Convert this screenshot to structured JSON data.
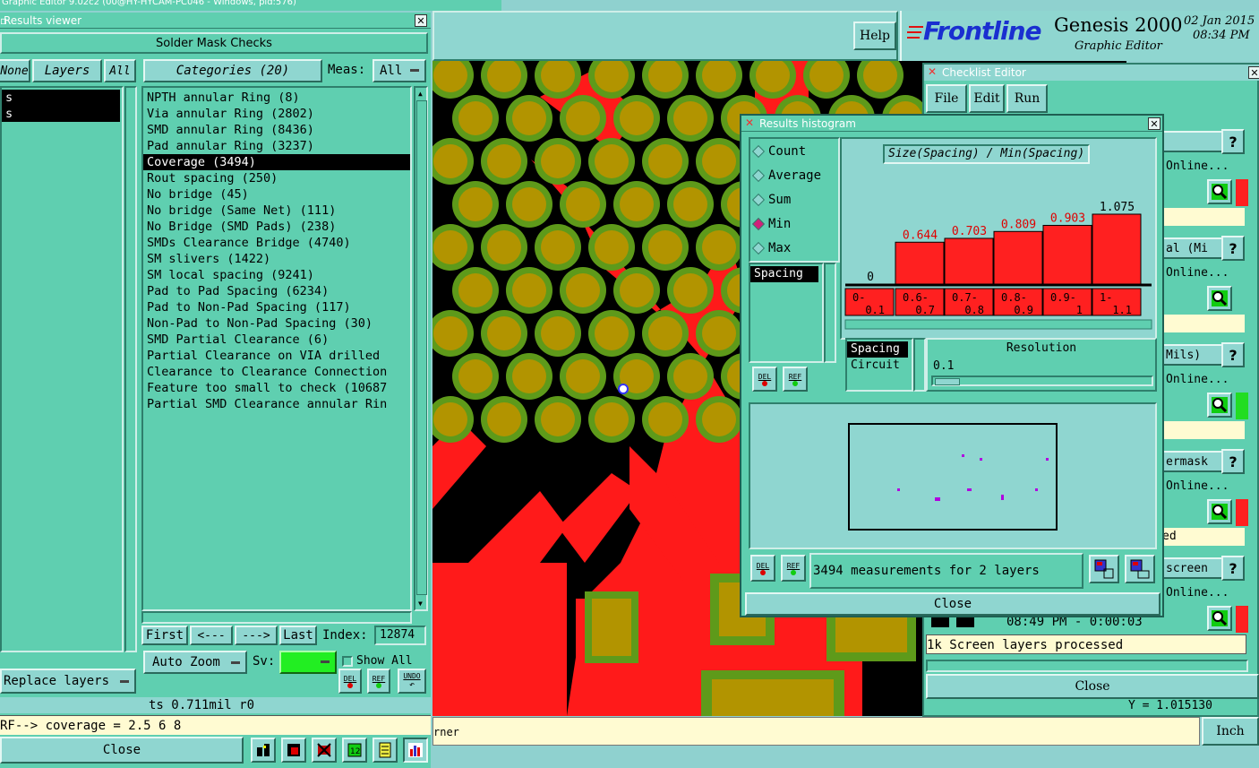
{
  "app": {
    "title": "Graphic Editor 9.02c2 (00@HY-HYCAM-PC046 - Windows, pid:576)",
    "help": "Help",
    "brand": "Frontline",
    "product": "Genesis 2000",
    "subtitle": "Graphic Editor",
    "date": "02 Jan 2015",
    "time": "08:34 PM",
    "bottom_msg": "rner",
    "units": "Inch"
  },
  "results_viewer": {
    "title": "Results viewer",
    "heading": "Solder Mask Checks",
    "none_label": "None",
    "layers_label": "Layers",
    "all_label": "All",
    "categories_label": "Categories (20)",
    "meas_label": "Meas:",
    "meas_value": "All",
    "layers": [
      "s",
      "s"
    ],
    "categories": [
      "NPTH annular Ring (8)",
      "Via annular Ring (2802)",
      "SMD annular Ring (8436)",
      "Pad annular Ring (3237)",
      "Coverage (3494)",
      "Rout spacing (250)",
      "No bridge (45)",
      "No bridge (Same Net) (111)",
      "No Bridge (SMD Pads) (238)",
      "SMDs Clearance Bridge (4740)",
      "SM slivers (1422)",
      "SM local spacing (9241)",
      "Pad to Pad Spacing (6234)",
      "Pad to Non-Pad Spacing (117)",
      "Non-Pad to Non-Pad Spacing (30)",
      "SMD Partial Clearance (6)",
      "Partial Clearance on VIA drilled",
      "Clearance to Clearance Connection",
      "Feature too small to check (10687",
      "Partial SMD Clearance annular Rin"
    ],
    "selected_category": 4,
    "first": "First",
    "prev": "<---",
    "next": "--->",
    "last": "Last",
    "index_label": "Index:",
    "index_value": "12874",
    "auto_zoom": "Auto Zoom",
    "sv_label": "Sv:",
    "show_all": "Show All",
    "replace_layers": "Replace layers",
    "del": "DEL",
    "ref": "REF",
    "undo": "UNDO",
    "status": "ts 0.711mil  r0",
    "message": "RF--> coverage = 2.5 6 8",
    "close": "Close"
  },
  "histogram": {
    "title": "Results histogram",
    "radios": [
      "Count",
      "Average",
      "Sum",
      "Min",
      "Max"
    ],
    "selected_radio": "Min",
    "chart_title": "Size(Spacing) / Min(Spacing)",
    "list1": [
      "Spacing"
    ],
    "list2": [
      "Spacing",
      "Circuit"
    ],
    "resolution_label": "Resolution",
    "resolution_value": "0.1",
    "measurements": "3494 measurements for 2 layers",
    "close": "Close",
    "del": "DEL",
    "ref": "REF"
  },
  "chart_data": {
    "type": "bar",
    "title": "Size(Spacing) / Min(Spacing)",
    "categories": [
      [
        "0-",
        "0.1"
      ],
      [
        "0.6-",
        "0.7"
      ],
      [
        "0.7-",
        "0.8"
      ],
      [
        "0.8-",
        "0.9"
      ],
      [
        "0.9-",
        "1"
      ],
      [
        "1-",
        "1.1"
      ]
    ],
    "values": [
      0,
      0.644,
      0.703,
      0.809,
      0.903,
      1.075
    ],
    "labels": [
      "0",
      "0.644",
      "0.703",
      "0.809",
      "0.903",
      "1.075"
    ],
    "bar_color": "#ff2020",
    "ylim": [
      0,
      1.075
    ]
  },
  "checklist": {
    "title": "Checklist Editor",
    "menu": [
      "File",
      "Edit",
      "Run"
    ],
    "rows": [
      {
        "text": "Online...",
        "tag": "",
        "status": "#ff2020"
      },
      {
        "text": "Online...",
        "tag": "al (Mi",
        "status": ""
      },
      {
        "text": "Online...",
        "tag": "Mils)",
        "status": "#22dd22"
      },
      {
        "text": "Online...",
        "tag": "ermask",
        "status": "#ff2020"
      },
      {
        "text": "Online...",
        "tag": "screen",
        "status": "#ff2020"
      }
    ],
    "yellow_texts": [
      "",
      "",
      "",
      "ed",
      ""
    ],
    "time": "08:49 PM - 0:00:03",
    "processed": "1k Screen layers processed",
    "close": "Close",
    "coord": "Y = 1.015130"
  },
  "colors": {
    "teal": "#5fcfb0",
    "pale": "#8fd6d0",
    "copper_red": "#ff1a1a",
    "pad_olive": "#b29400",
    "pad_green": "#5e9a1a"
  }
}
